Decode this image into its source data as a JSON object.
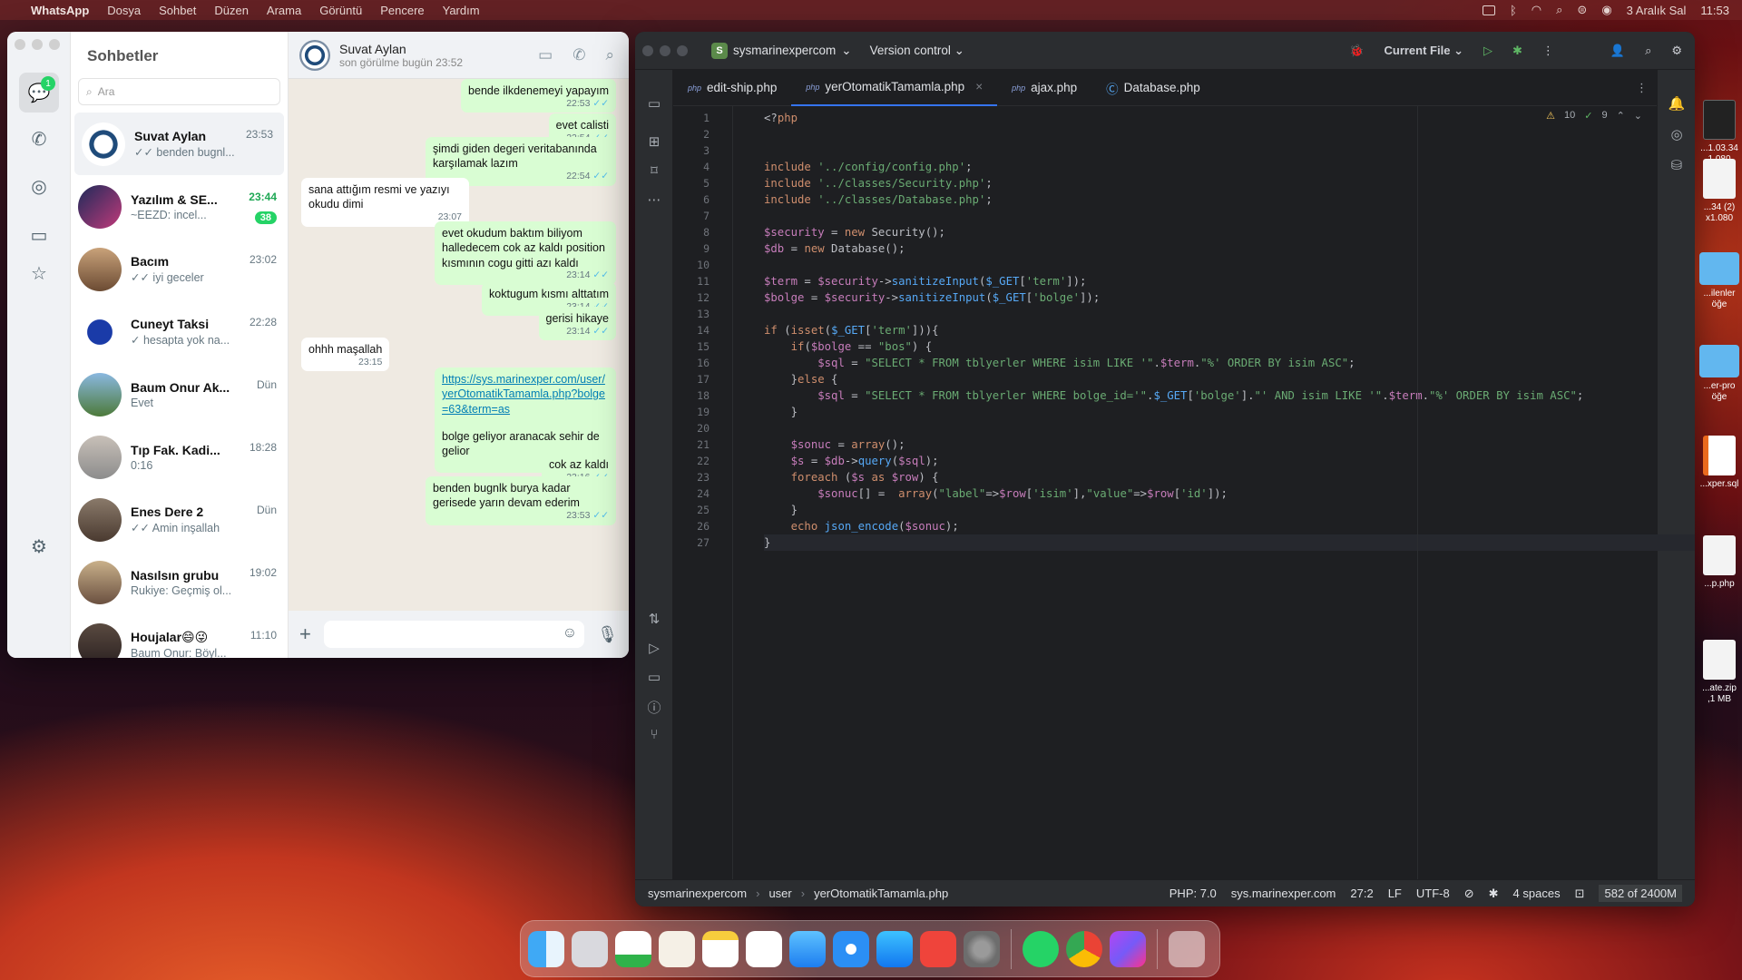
{
  "menubar": {
    "app": "WhatsApp",
    "items": [
      "Dosya",
      "Sohbet",
      "Düzen",
      "Arama",
      "Görüntü",
      "Pencere",
      "Yardım"
    ],
    "date": "3 Aralık Sal",
    "time": "11:53"
  },
  "whatsapp": {
    "unread_badge": "1",
    "list_title": "Sohbetler",
    "search_placeholder": "Ara",
    "chats": [
      {
        "name": "Suvat Aylan",
        "time": "23:53",
        "preview": "✓✓ benden bugnl...",
        "selected": true
      },
      {
        "name": "Yazılım & SE...",
        "time": "23:44",
        "preview": "~EEZD: incel...",
        "count": "38",
        "highlight": true
      },
      {
        "name": "Bacım",
        "time": "23:02",
        "preview": "✓✓ iyi geceler"
      },
      {
        "name": "Cuneyt Taksi",
        "time": "22:28",
        "preview": "✓ hesapta yok na..."
      },
      {
        "name": "Baum Onur Ak...",
        "time": "Dün",
        "preview": "Evet"
      },
      {
        "name": "Tıp Fak. Kadi...",
        "time": "18:28",
        "preview": "0:16"
      },
      {
        "name": "Enes Dere 2",
        "time": "Dün",
        "preview": "✓✓ Amin inşallah"
      },
      {
        "name": "Nasılsın grubu",
        "time": "19:02",
        "preview": "Rukiye: Geçmiş ol..."
      },
      {
        "name": "Houjalar😄😜",
        "time": "11:10",
        "preview": "Baum Onur: Böyl..."
      }
    ],
    "conversation": {
      "name": "Suvat Aylan",
      "status": "son görülme bugün 23:52",
      "messages": [
        {
          "dir": "out",
          "text": "bende ilkdenemeyi yapayım",
          "time": "22:53"
        },
        {
          "dir": "out",
          "text": "evet calisti",
          "time": "22:54"
        },
        {
          "dir": "out",
          "text": "şimdi giden degeri veritabanında karşılamak lazım",
          "time": "22:54"
        },
        {
          "dir": "in",
          "text": "sana attığım resmi ve yazıyı okudu dimi",
          "time": "23:07"
        },
        {
          "dir": "out",
          "text": "evet okudum baktım biliyom halledecem cok az kaldı position kısmının cogu gitti azı kaldı",
          "time": "23:14"
        },
        {
          "dir": "out",
          "text": "koktugum kısmı alttatım",
          "time": "23:14"
        },
        {
          "dir": "out",
          "text": "gerisi hikaye",
          "time": "23:14"
        },
        {
          "dir": "in",
          "text": "ohhh maşallah",
          "time": "23:15"
        },
        {
          "dir": "out",
          "link": "https://sys.marinexper.com/user/yerOtomatikTamamla.php?bolge=63&term=as",
          "text": "bolge geliyor aranacak sehir de gelior",
          "time": "23:16"
        },
        {
          "dir": "out",
          "text": "cok az kaldı",
          "time": "23:16"
        },
        {
          "dir": "out",
          "text": "benden bugnlk burya kadar gerisede yarın devam ederim",
          "time": "23:53"
        }
      ]
    }
  },
  "ide": {
    "project": "sysmarinexpercom",
    "project_initial": "S",
    "vcs": "Version control",
    "run_config": "Current File",
    "tabs": [
      {
        "name": "edit-ship.php"
      },
      {
        "name": "yerOtomatikTamamla.php",
        "active": true
      },
      {
        "name": "ajax.php"
      },
      {
        "name": "Database.php"
      }
    ],
    "inspections": {
      "warnings": "10",
      "ok": "9"
    },
    "code": [
      "<?php",
      "",
      "",
      "include '../config/config.php';",
      "include '../classes/Security.php';",
      "include '../classes/Database.php';",
      "",
      "$security = new Security();",
      "$db = new Database();",
      "",
      "$term = $security->sanitizeInput($_GET['term']);",
      "$bolge = $security->sanitizeInput($_GET['bolge']);",
      "",
      "if (isset($_GET['term'])){",
      "    if($bolge == \"bos\") {",
      "        $sql = \"SELECT * FROM tblyerler WHERE isim LIKE '\".$term.\"%' ORDER BY isim ASC\";",
      "    }else {",
      "        $sql = \"SELECT * FROM tblyerler WHERE bolge_id='\".$_GET['bolge'].\"' AND isim LIKE '\".$term.\"%' ORDER BY isim ASC\";",
      "    }",
      "",
      "    $sonuc = array();",
      "    $s = $db->query($sql);",
      "    foreach ($s as $row) {",
      "        $sonuc[] =  array(\"label\"=>$row['isim'],\"value\"=>$row['id']);",
      "    }",
      "    echo json_encode($sonuc);",
      "}"
    ],
    "current_line": 27,
    "status": {
      "breadcrumb": [
        "sysmarinexpercom",
        "user",
        "yerOtomatikTamamla.php"
      ],
      "php": "PHP: 7.0",
      "server": "sys.marinexper.com",
      "pos": "27:2",
      "eol": "LF",
      "enc": "UTF-8",
      "indent": "4 spaces",
      "mem": "582 of 2400M"
    }
  },
  "desktop": [
    {
      "label": "...1.03.34\n1.080"
    },
    {
      "label": "...34 (2)\nx1.080"
    },
    {
      "label": "...ilenler\nöğe"
    },
    {
      "label": "...er-pro\nöğe"
    },
    {
      "label": "...xper.sql"
    },
    {
      "label": "...p.php"
    },
    {
      "label": "...ate.zip\n,1 MB"
    }
  ],
  "dock": [
    "finder",
    "launchpad",
    "numbers",
    "freeform-notes",
    "notes",
    "freeform",
    "mail",
    "safari",
    "app-store",
    "anydesk",
    "settings",
    "whatsapp",
    "chrome",
    "phpstorm",
    "trash"
  ]
}
